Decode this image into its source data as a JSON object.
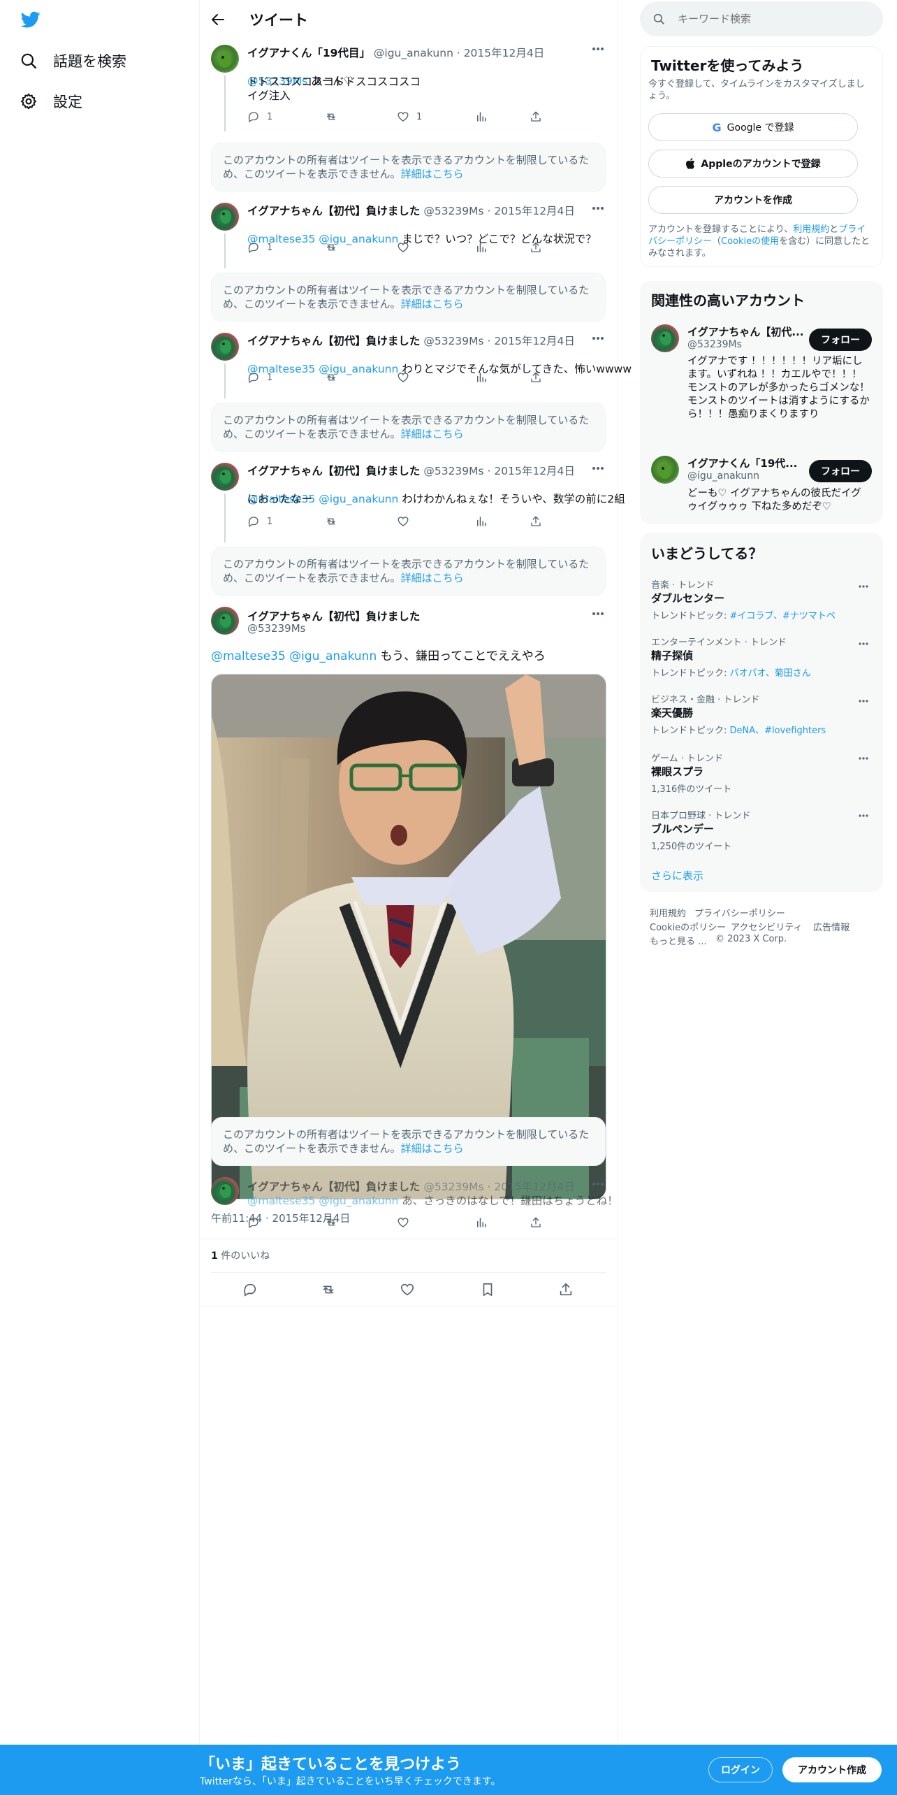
{
  "sidebar": {
    "items": [
      {
        "label": "話題を検索",
        "icon": "search-icon"
      },
      {
        "label": "設定",
        "icon": "gear-icon"
      }
    ]
  },
  "header": {
    "title": "ツイート"
  },
  "tweets": [
    {
      "name": "イグアナくん「19代目」",
      "handle": "@igu_anakunn",
      "date": "· 2015年12月4日",
      "mention": "@53239Ms",
      "text_after_mention": " あーん♡",
      "text": "ドドスコスコスコドドスコスコスコ\nイグ注入",
      "reply_count": "1",
      "like_count": "1"
    },
    {
      "name": "イグアナちゃん【初代】負けました",
      "handle": "@53239Ms",
      "date": "· 2015年12月4日",
      "mention": "@maltese35 @igu_anakunn",
      "text_after_mention": " まじで？いつ？どこで？どんな状況で？",
      "reply_count": "1"
    },
    {
      "name": "イグアナちゃん【初代】負けました",
      "handle": "@53239Ms",
      "date": "· 2015年12月4日",
      "mention": "@maltese35 @igu_anakunn",
      "text_after_mention": " わりとマジでそんな気がしてきた、怖いwwww",
      "reply_count": "1"
    },
    {
      "name": "イグアナちゃん【初代】負けました",
      "handle": "@53239Ms",
      "date": "· 2015年12月4日",
      "mention": "@maltese35 @igu_anakunn",
      "text_after_mention": " わけわかんねぇな！そういや、数学の前に2組",
      "text_line2": "におったなー",
      "reply_count": "1"
    }
  ],
  "restricted_notice": {
    "text": "このアカウントの所有者はツイートを表示できるアカウントを制限しているため、このツイートを表示できません。",
    "link": "詳細はこちら"
  },
  "main_tweet": {
    "name": "イグアナちゃん【初代】負けました",
    "handle": "@53239Ms",
    "mention": "@maltese35 @igu_anakunn",
    "text_after_mention": " もう、鎌田ってことでええやろ",
    "timestamp": "午前11:44 · 2015年12月4日",
    "likes_number": "1",
    "likes_label": " 件のいいね"
  },
  "overlap_tweet": {
    "name": "イグアナちゃん【初代】負けました",
    "handle": "@53239Ms",
    "date": "· 2015年12月4日",
    "mention": "@maltese35 @igu_anakunn",
    "text_after_mention": " あ、さっきのはなしで！鎌田はちょうとね！"
  },
  "search": {
    "placeholder": "キーワード検索"
  },
  "signup": {
    "title": "Twitterを使ってみよう",
    "subtitle": "今すぐ登録して、タイムラインをカスタマイズしましょう。",
    "google_button": "Google で登録",
    "apple_button": "Appleのアカウントで登録",
    "create_button": "アカウントを作成",
    "legal_pre": "アカウントを登録することにより、",
    "legal_terms": "利用規約",
    "legal_and": "と",
    "legal_privacy": "プライバシーポリシー",
    "legal_paren_open": "（",
    "legal_cookie": "Cookieの使用",
    "legal_post": "を含む）に同意したとみなされます。"
  },
  "related": {
    "title": "関連性の高いアカウント",
    "accounts": [
      {
        "name": "イグアナちゃん【初代...",
        "handle": "@53239Ms",
        "bio": "イグアナです ！！！！！！リア垢にします。いずれね ！！カエルやで！！！ モンストのアレが多かったらゴメンな！モンストのツイートは消すようにするから！！！愚痴りまくりますり",
        "follow": "フォロー"
      },
      {
        "name": "イグアナくん「19代...",
        "handle": "@igu_anakunn",
        "bio": "どーも♡ イグアナちゃんの彼氏だイグゥイグゥゥゥ 下ねた多めだぞ♡",
        "follow": "フォロー"
      }
    ]
  },
  "trends": {
    "title": "いまどうしてる？",
    "items": [
      {
        "category": "音楽 · トレンド",
        "name": "ダブルセンター",
        "meta_label": "トレンドトピック: ",
        "meta_links": "#イコラブ、#ナツマトペ"
      },
      {
        "category": "エンターテインメント · トレンド",
        "name": "精子探偵",
        "meta_label": "トレンドトピック: ",
        "meta_links": "パオパオ、菊田さん"
      },
      {
        "category": "ビジネス・金融 · トレンド",
        "name": "楽天優勝",
        "meta_label": "トレンドトピック: ",
        "meta_links": "DeNA、#lovefighters"
      },
      {
        "category": "ゲーム · トレンド",
        "name": "裸眼スプラ",
        "meta_plain": "1,316件のツイート"
      },
      {
        "category": "日本プロ野球 · トレンド",
        "name": "ブルペンデー",
        "meta_plain": "1,250件のツイート"
      }
    ],
    "show_more": "さらに表示"
  },
  "footer": {
    "row1": [
      "利用規約",
      "プライバシーポリシー"
    ],
    "row2": [
      "Cookieのポリシー",
      "アクセシビリティ",
      "広告情報"
    ],
    "row3": [
      "もっと見る ...",
      "© 2023 X Corp."
    ]
  },
  "bottom_bar": {
    "title": "「いま」起きていることを見つけよう",
    "subtitle": "Twitterなら、「いま」起きていることをいち早くチェックできます。",
    "login": "ログイン",
    "signup": "アカウント作成"
  },
  "colors": {
    "accent": "#1d9bf0",
    "bottom_bar": "#1d9bf0",
    "text": "#0f1419",
    "muted": "#536471"
  }
}
